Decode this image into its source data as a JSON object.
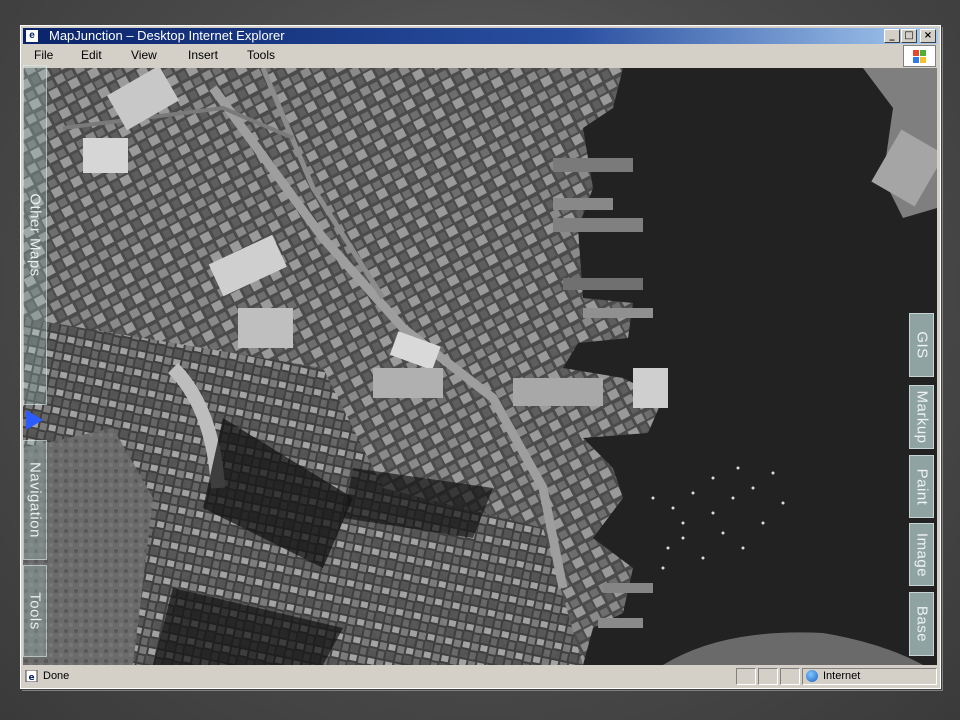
{
  "window": {
    "title": "MapJunction – Desktop  Internet Explorer",
    "buttons": {
      "minimize": "_",
      "maximize": "□",
      "close": "×"
    }
  },
  "menu": [
    "File",
    "Edit",
    "View",
    "Insert",
    "Tools"
  ],
  "left_tabs": [
    {
      "label": "Other Maps"
    },
    {
      "label": "Navigation"
    },
    {
      "label": "Tools"
    }
  ],
  "right_tabs": [
    {
      "label": "GIS"
    },
    {
      "label": "Markup"
    },
    {
      "label": "Paint"
    },
    {
      "label": "Image"
    },
    {
      "label": "Base"
    }
  ],
  "map": {
    "imagery": "aerial grayscale city waterfront"
  },
  "status": {
    "text": "Done",
    "zone": "Internet"
  },
  "colors": {
    "title_gradient_start": "#0a246a",
    "tab_fill": "#8fa3a2",
    "arrow": "#2a5cff"
  }
}
